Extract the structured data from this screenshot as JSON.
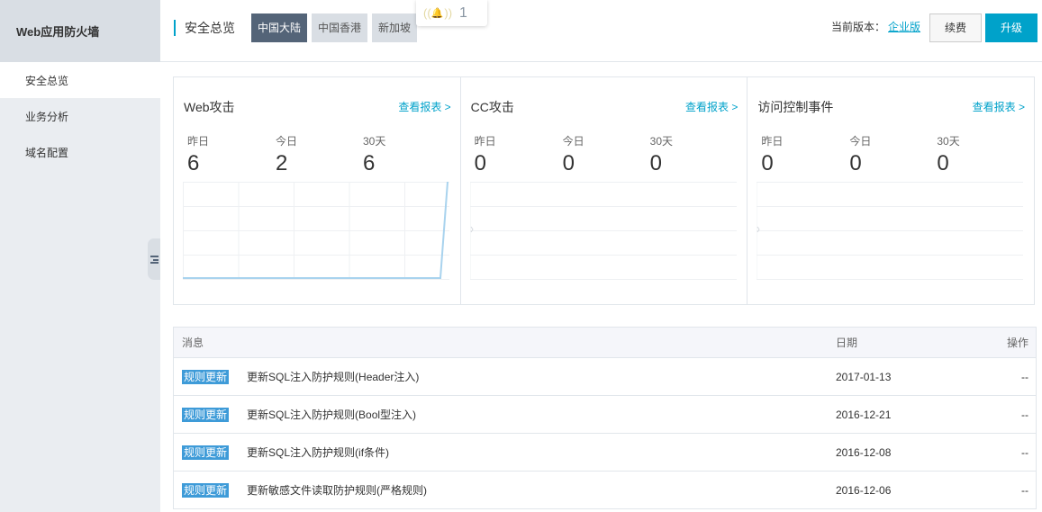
{
  "sidebar": {
    "title": "Web应用防火墙",
    "items": [
      {
        "label": "安全总览",
        "active": true
      },
      {
        "label": "业务分析",
        "active": false
      },
      {
        "label": "域名配置",
        "active": false
      }
    ]
  },
  "header": {
    "title": "安全总览",
    "regions": [
      {
        "label": "中国大陆",
        "active": true
      },
      {
        "label": "中国香港",
        "active": false
      },
      {
        "label": "新加坡",
        "active": false
      }
    ],
    "notification_count": "1",
    "version_label": "当前版本：",
    "version_value": "企业版",
    "renew_label": "续费",
    "upgrade_label": "升级"
  },
  "panels": [
    {
      "title": "Web攻击",
      "link": "查看报表 >",
      "stats": [
        {
          "label": "昨日",
          "value": "6"
        },
        {
          "label": "今日",
          "value": "2"
        },
        {
          "label": "30天",
          "value": "6"
        }
      ],
      "trend": "spike"
    },
    {
      "title": "CC攻击",
      "link": "查看报表 >",
      "stats": [
        {
          "label": "昨日",
          "value": "0"
        },
        {
          "label": "今日",
          "value": "0"
        },
        {
          "label": "30天",
          "value": "0"
        }
      ],
      "trend": "flat"
    },
    {
      "title": "访问控制事件",
      "link": "查看报表 >",
      "stats": [
        {
          "label": "昨日",
          "value": "0"
        },
        {
          "label": "今日",
          "value": "0"
        },
        {
          "label": "30天",
          "value": "0"
        }
      ],
      "trend": "flat"
    }
  ],
  "messages": {
    "columns": {
      "msg": "消息",
      "date": "日期",
      "op": "操作"
    },
    "rows": [
      {
        "tag": "规则更新",
        "text": "更新SQL注入防护规则(Header注入)",
        "date": "2017-01-13",
        "op": "--"
      },
      {
        "tag": "规则更新",
        "text": "更新SQL注入防护规则(Bool型注入)",
        "date": "2016-12-21",
        "op": "--"
      },
      {
        "tag": "规则更新",
        "text": "更新SQL注入防护规则(if条件)",
        "date": "2016-12-08",
        "op": "--"
      },
      {
        "tag": "规则更新",
        "text": "更新敏感文件读取防护规则(严格规则)",
        "date": "2016-12-06",
        "op": "--"
      }
    ]
  },
  "colors": {
    "accent": "#00a2ca",
    "tag": "#3e9bd8",
    "sidebar_bg": "#eaedf1",
    "active_region": "#546478",
    "chart_line": "#a9d3ee"
  }
}
